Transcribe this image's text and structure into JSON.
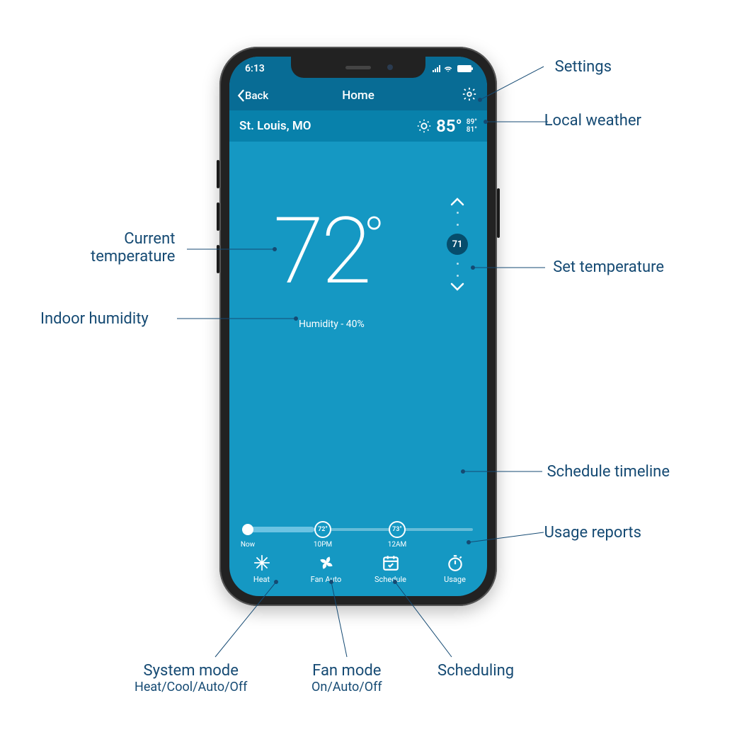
{
  "statusbar": {
    "time": "6:13"
  },
  "nav": {
    "back": "Back",
    "title": "Home"
  },
  "weather": {
    "location": "St. Louis, MO",
    "temp": "85°",
    "high": "89°",
    "low": "81°"
  },
  "current": {
    "temp": "72",
    "deg": "°",
    "humidity": "Humidity - 40%"
  },
  "setpoint": {
    "value": "71"
  },
  "timeline": {
    "now_label": "Now",
    "points": [
      {
        "label": "10PM",
        "temp": "72°",
        "pos": 100
      },
      {
        "label": "12AM",
        "temp": "73°",
        "pos": 205
      }
    ]
  },
  "tabs": {
    "heat": "Heat",
    "fan": "Fan Auto",
    "schedule": "Schedule",
    "usage": "Usage"
  },
  "annotations": {
    "settings": "Settings",
    "local_weather": "Local weather",
    "current_temp": "Current\ntemperature",
    "indoor_humidity": "Indoor humidity",
    "set_temp": "Set temperature",
    "schedule_timeline": "Schedule timeline",
    "usage_reports": "Usage reports",
    "system_mode": "System mode",
    "system_mode_sub": "Heat/Cool/Auto/Off",
    "fan_mode": "Fan mode",
    "fan_mode_sub": "On/Auto/Off",
    "scheduling": "Scheduling"
  }
}
